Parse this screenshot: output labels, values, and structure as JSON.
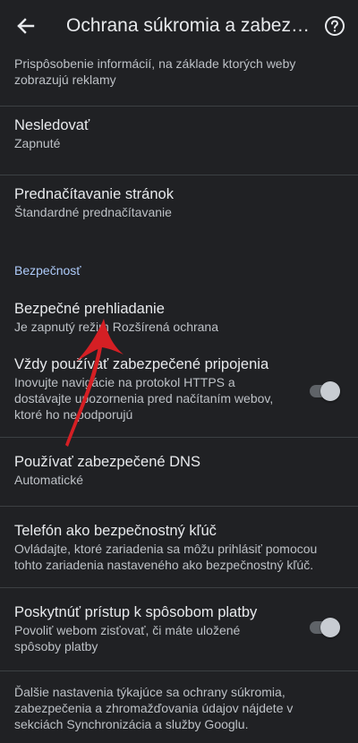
{
  "appbar": {
    "title": "Ochrana súkromia a zabezpečenie",
    "back_icon": "arrow-back-icon",
    "help_icon": "help-icon"
  },
  "partial_summary": "Prispôsobenie informácií, na základe ktorých weby zobrazujú reklamy",
  "items": {
    "do_not_track": {
      "title": "Nesledovať",
      "summary": "Zapnuté"
    },
    "preload": {
      "title": "Prednačítavanie stránok",
      "summary": "Štandardné prednačítavanie"
    }
  },
  "security_section": {
    "header": "Bezpečnosť",
    "safe_browsing": {
      "title": "Bezpečné prehliadanie",
      "summary": "Je zapnutý režim Rozšírená ochrana"
    },
    "https_first": {
      "title": "Vždy používať zabezpečené pripojenia",
      "summary": "Inovujte navigácie na protokol HTTPS a dostávajte upozornenia pred načítaním webov, ktoré ho nepodporujú",
      "enabled": true
    },
    "secure_dns": {
      "title": "Používať zabezpečené DNS",
      "summary": "Automatické"
    },
    "phone_key": {
      "title": "Telefón ako bezpečnostný kľúč",
      "summary": "Ovládajte, ktoré zariadenia sa môžu prihlásiť pomocou tohto zariadenia nastaveného ako bezpečnostný kľúč."
    },
    "payment_methods": {
      "title": "Poskytnúť prístup k spôsobom platby",
      "summary": "Povoliť webom zisťovať, či máte uložené spôsoby platby",
      "enabled": true
    }
  },
  "footer": "Ďalšie nastavenia týkajúce sa ochrany súkromia, zabezpečenia a zhromažďovania údajov nájdete v sekciách Synchronizácia a služby Googlu.",
  "colors": {
    "background": "#202124",
    "text_primary": "#e8eaed",
    "text_secondary": "#bdc1c6",
    "section_header": "#aecbfa",
    "annotation_arrow": "#d51f24"
  }
}
